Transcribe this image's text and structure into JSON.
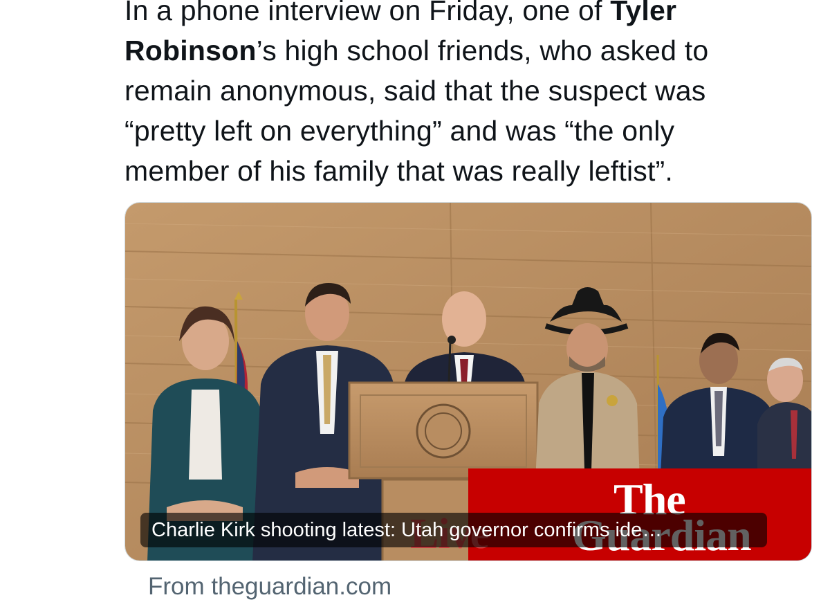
{
  "post": {
    "line1_a": "In a phone interview on Friday, one of ",
    "line1_b": "Tyler",
    "line2_a": "Robinson",
    "line2_b": "’s high school friends, who asked to",
    "line3": "remain anonymous, said that the suspect was",
    "line4": "“pretty left on everything” and was “the only",
    "line5": "member of his family that was really leftist”."
  },
  "card": {
    "caption": "Charlie Kirk shooting latest: Utah governor confirms ide…",
    "brand_the": "The",
    "brand_live": "Live",
    "brand_guardian": "Guardian",
    "source": "From theguardian.com"
  },
  "colors": {
    "brand_red": "#c70000",
    "source_gray": "#536471",
    "wall": "#b58a5c"
  }
}
